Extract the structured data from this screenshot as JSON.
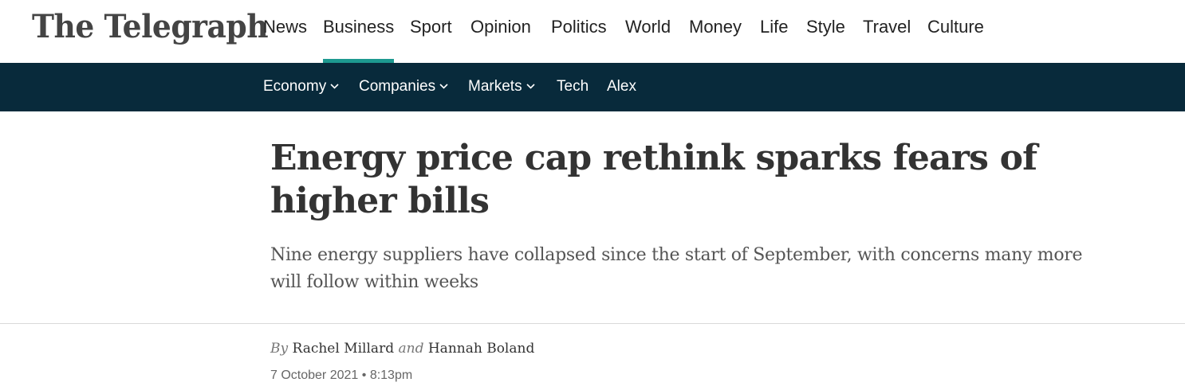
{
  "site": {
    "logo_text": "The Telegraph"
  },
  "main_nav": [
    {
      "label": "News"
    },
    {
      "label": "Business",
      "active": true
    },
    {
      "label": "Sport"
    },
    {
      "label": "Opinion"
    },
    {
      "label": "Politics"
    },
    {
      "label": "World"
    },
    {
      "label": "Money"
    },
    {
      "label": "Life"
    },
    {
      "label": "Style"
    },
    {
      "label": "Travel"
    },
    {
      "label": "Culture"
    }
  ],
  "sub_nav": [
    {
      "label": "Economy",
      "has_dropdown": true,
      "icon": "chevron-down-icon"
    },
    {
      "label": "Companies",
      "has_dropdown": true,
      "icon": "chevron-down-icon"
    },
    {
      "label": "Markets",
      "has_dropdown": true,
      "icon": "chevron-down-icon"
    },
    {
      "label": "Tech"
    },
    {
      "label": "Alex"
    }
  ],
  "article": {
    "headline": "Energy price cap rethink sparks fears of higher bills",
    "standfirst": "Nine energy suppliers have collapsed since the start of September, with concerns many more will follow within weeks",
    "byline": {
      "prefix": "By",
      "authors": [
        "Rachel Millard",
        "Hannah Boland"
      ],
      "conjunction": "and"
    },
    "date": "7 October 2021",
    "separator": "•",
    "time": "8:13pm"
  },
  "colors": {
    "subnav_bg": "#082a3b",
    "active_underline": "#1d9990",
    "text": "#333333"
  }
}
